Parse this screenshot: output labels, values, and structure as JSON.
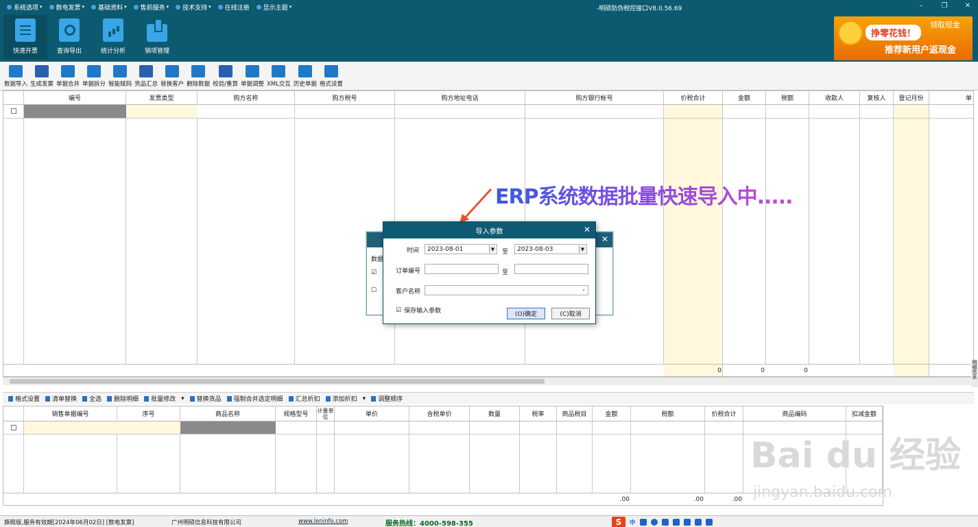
{
  "menubar": {
    "items": [
      {
        "label": "系统选项"
      },
      {
        "label": "数电发票"
      },
      {
        "label": "基础资料"
      },
      {
        "label": "售前服务"
      },
      {
        "label": "技术支持"
      },
      {
        "label": "在线注册"
      },
      {
        "label": "显示主题"
      }
    ],
    "title": "-明硕防伪税控接口V8.0.56.69"
  },
  "bigtools": [
    {
      "label": "快速开票"
    },
    {
      "label": "查询导出"
    },
    {
      "label": "统计分析"
    },
    {
      "label": "销项管理"
    }
  ],
  "ad": {
    "pill": "挣零花钱！",
    "right": "领取现金",
    "bottom": "推荐新用户返现金"
  },
  "toolbar": [
    {
      "label": "数据导入"
    },
    {
      "label": "生成发票"
    },
    {
      "label": "单据合并"
    },
    {
      "label": "单据拆分"
    },
    {
      "label": "智能赋码"
    },
    {
      "label": "货品汇总"
    },
    {
      "label": "替换客户"
    },
    {
      "label": "删除数据"
    },
    {
      "label": "校验/重算"
    },
    {
      "label": "单据调整"
    },
    {
      "label": "XML交互"
    },
    {
      "label": "历史单据"
    },
    {
      "label": "格式设置"
    }
  ],
  "top_grid": {
    "headers": [
      "",
      "编号",
      "发票类型",
      "购方名称",
      "购方税号",
      "购方地址电话",
      "购方银行帐号",
      "价税合计",
      "金额",
      "税额",
      "收款人",
      "复核人",
      "登记月份",
      "单"
    ],
    "sums": {
      "total": "0",
      "amount": "0",
      "tax": "0"
    }
  },
  "annotation": "ERP系统数据批量快速导入中.....",
  "dialog": {
    "title": "导入参数",
    "time_label": "时间",
    "date_from": "2023-08-01",
    "to1": "至",
    "date_to": "2023-08-03",
    "order_label": "订单编号",
    "order_from": "",
    "to2": "至",
    "order_to": "",
    "customer_label": "客户名称",
    "customer": "",
    "save_label": "保存输入参数",
    "save_checked": true,
    "ok": "(O)确定",
    "cancel": "(C)取消"
  },
  "back_dialog": {
    "label": "数据"
  },
  "bottom_toolbar": [
    {
      "label": "格式设置"
    },
    {
      "label": "清单替换"
    },
    {
      "label": "全选"
    },
    {
      "label": "删除明细"
    },
    {
      "label": "批量修改"
    },
    {
      "label": "替换货品"
    },
    {
      "label": "强制合并选定明细"
    },
    {
      "label": "汇总折扣"
    },
    {
      "label": "添加折扣"
    },
    {
      "label": "调整顺序"
    }
  ],
  "bottom_grid": {
    "headers": [
      "",
      "销售单据编号",
      "序号",
      "商品名称",
      "规格型号",
      "计量单位",
      "单价",
      "含税单价",
      "数量",
      "税率",
      "商品税目",
      "金额",
      "税额",
      "价税合计",
      "商品编码",
      "扣减金额"
    ],
    "sums": {
      "amount": ".00",
      "tax": ".00",
      "total": ".00"
    }
  },
  "status": {
    "left": "旗舰版,服务有效期[2024年06月02日] [数电发票]",
    "company": "广州明硕信息科技有限公司",
    "url": "www.leninfo.com",
    "hotline": "服务热线：4000-598-355"
  },
  "ime": {
    "lang": "中"
  },
  "watermark": {
    "main": "Bai du 经验",
    "sub": "jingyan.baidu.com"
  },
  "side_label": "明细信息"
}
